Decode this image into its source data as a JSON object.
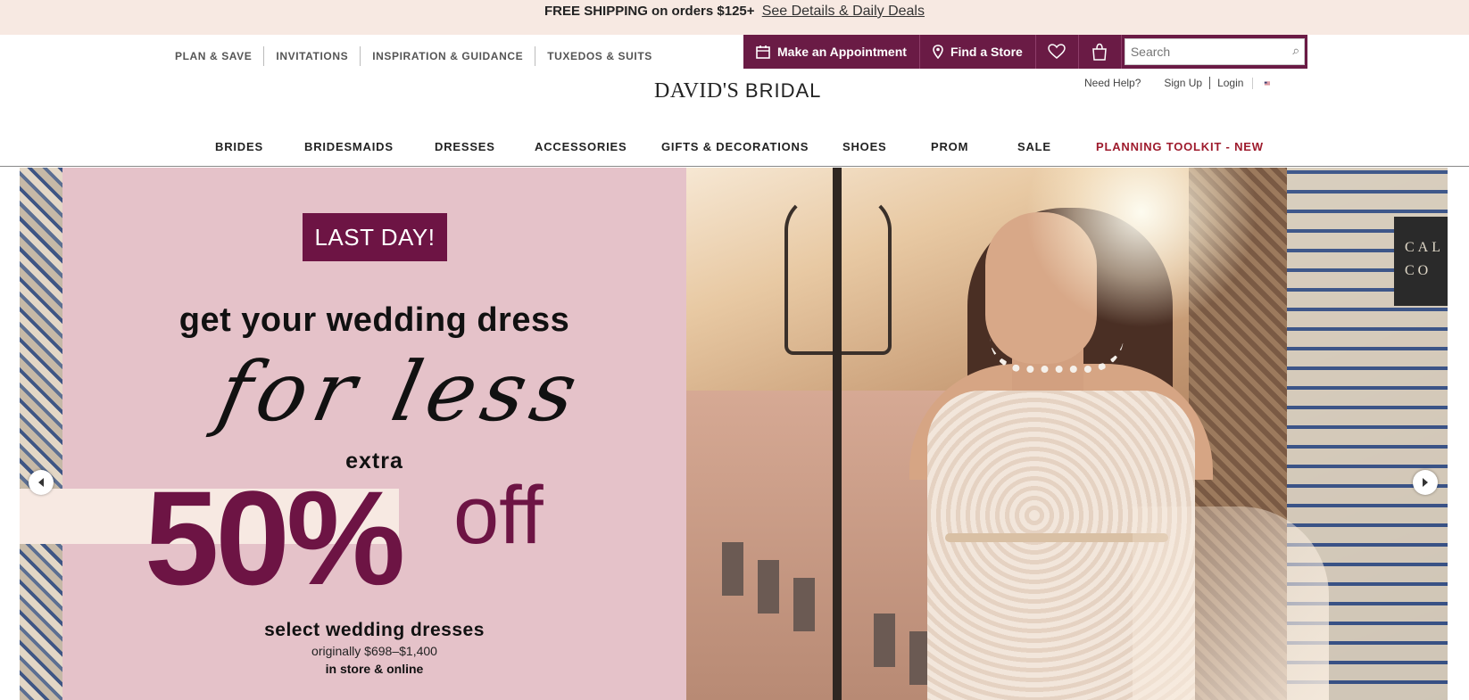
{
  "promo": {
    "bold": "FREE SHIPPING on orders $125+",
    "link": "See Details & Daily Deals"
  },
  "util_links": [
    "PLAN & SAVE",
    "INVITATIONS",
    "INSPIRATION & GUIDANCE",
    "TUXEDOS & SUITS"
  ],
  "actions": {
    "appointment": "Make an Appointment",
    "find_store": "Find a Store",
    "search_placeholder": "Search"
  },
  "logo": {
    "name": "DAVID'S",
    "suffix": "BRIDAL"
  },
  "account": {
    "help": "Need Help?",
    "signup": "Sign Up",
    "login": "Login"
  },
  "main_nav": [
    "BRIDES",
    "BRIDESMAIDS",
    "DRESSES",
    "ACCESSORIES",
    "GIFTS & DECORATIONS",
    "SHOES",
    "PROM",
    "SALE",
    "PLANNING TOOLKIT - NEW"
  ],
  "hero": {
    "badge": "LAST DAY!",
    "headline": "get your wedding dress",
    "script": "for less",
    "extra": "extra",
    "percent": "50%",
    "off": "off",
    "select": "select wedding dresses",
    "original": "originally $698–$1,400",
    "instore": "in store & online",
    "sign": "CAL CO"
  },
  "colors": {
    "brand": "#6a1b45",
    "promo_bg": "#f7e9e2",
    "hero_pink": "#e5c2c9",
    "planning": "#9e1b2d"
  }
}
